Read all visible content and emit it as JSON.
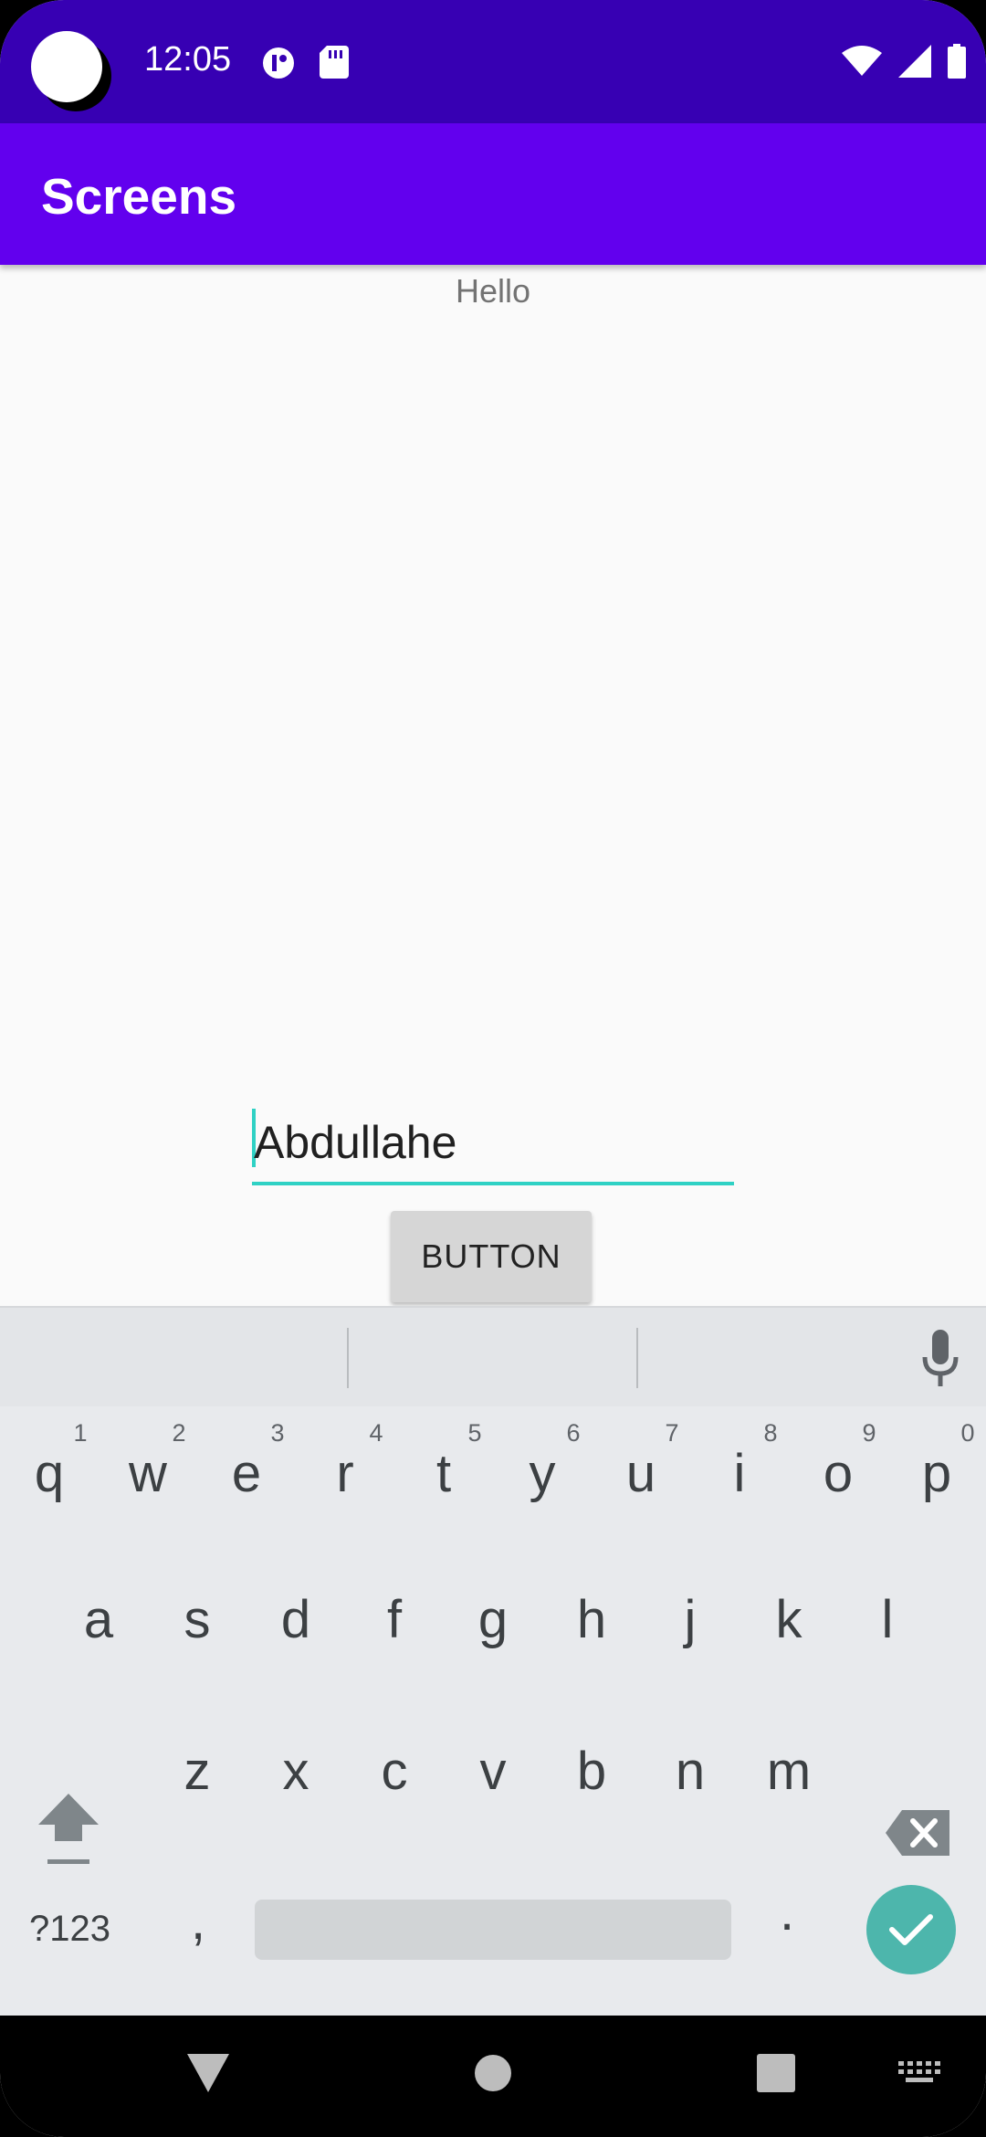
{
  "status_bar": {
    "time": "12:05",
    "icons": [
      "circle-avatar-icon",
      "data-saver-icon",
      "sd-card-icon",
      "wifi-icon",
      "signal-icon",
      "battery-icon"
    ]
  },
  "app_bar": {
    "title": "Screens"
  },
  "main": {
    "hello_text": "Hello",
    "name_field": {
      "value": "Abdullahe"
    },
    "button_label": "BUTTON"
  },
  "keyboard": {
    "row1": [
      "q",
      "w",
      "e",
      "r",
      "t",
      "y",
      "u",
      "i",
      "o",
      "p"
    ],
    "row1_hints": [
      "1",
      "2",
      "3",
      "4",
      "5",
      "6",
      "7",
      "8",
      "9",
      "0"
    ],
    "row2": [
      "a",
      "s",
      "d",
      "f",
      "g",
      "h",
      "j",
      "k",
      "l"
    ],
    "row3": [
      "z",
      "x",
      "c",
      "v",
      "b",
      "n",
      "m"
    ],
    "symbols_label": "?123",
    "comma": ",",
    "period": "."
  },
  "colors": {
    "status_bar": "#3700b3",
    "app_bar": "#6200ee",
    "accent": "#2fd1c4",
    "enter_key": "#4db6ac"
  }
}
